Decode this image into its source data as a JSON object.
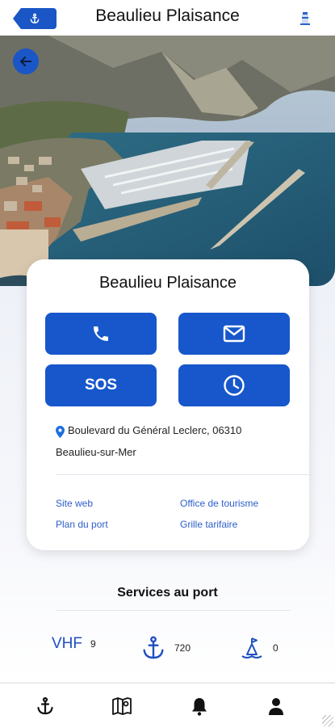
{
  "header": {
    "title": "Beaulieu Plaisance"
  },
  "card": {
    "title": "Beaulieu Plaisance",
    "actions": {
      "sos_label": "SOS"
    },
    "address_line1": "Boulevard du Général Leclerc, 06310",
    "address_line2": "Beaulieu-sur-Mer",
    "links": {
      "site_web": "Site web",
      "office": "Office de tourisme",
      "plan": "Plan du port",
      "grille": "Grille tarifaire"
    }
  },
  "services": {
    "title": "Services au port",
    "vhf_label": "VHF",
    "vhf_value": "9",
    "berths_value": "720",
    "buoy_value": "0"
  },
  "colors": {
    "accent": "#1757cb",
    "link": "#2c5fc9"
  }
}
